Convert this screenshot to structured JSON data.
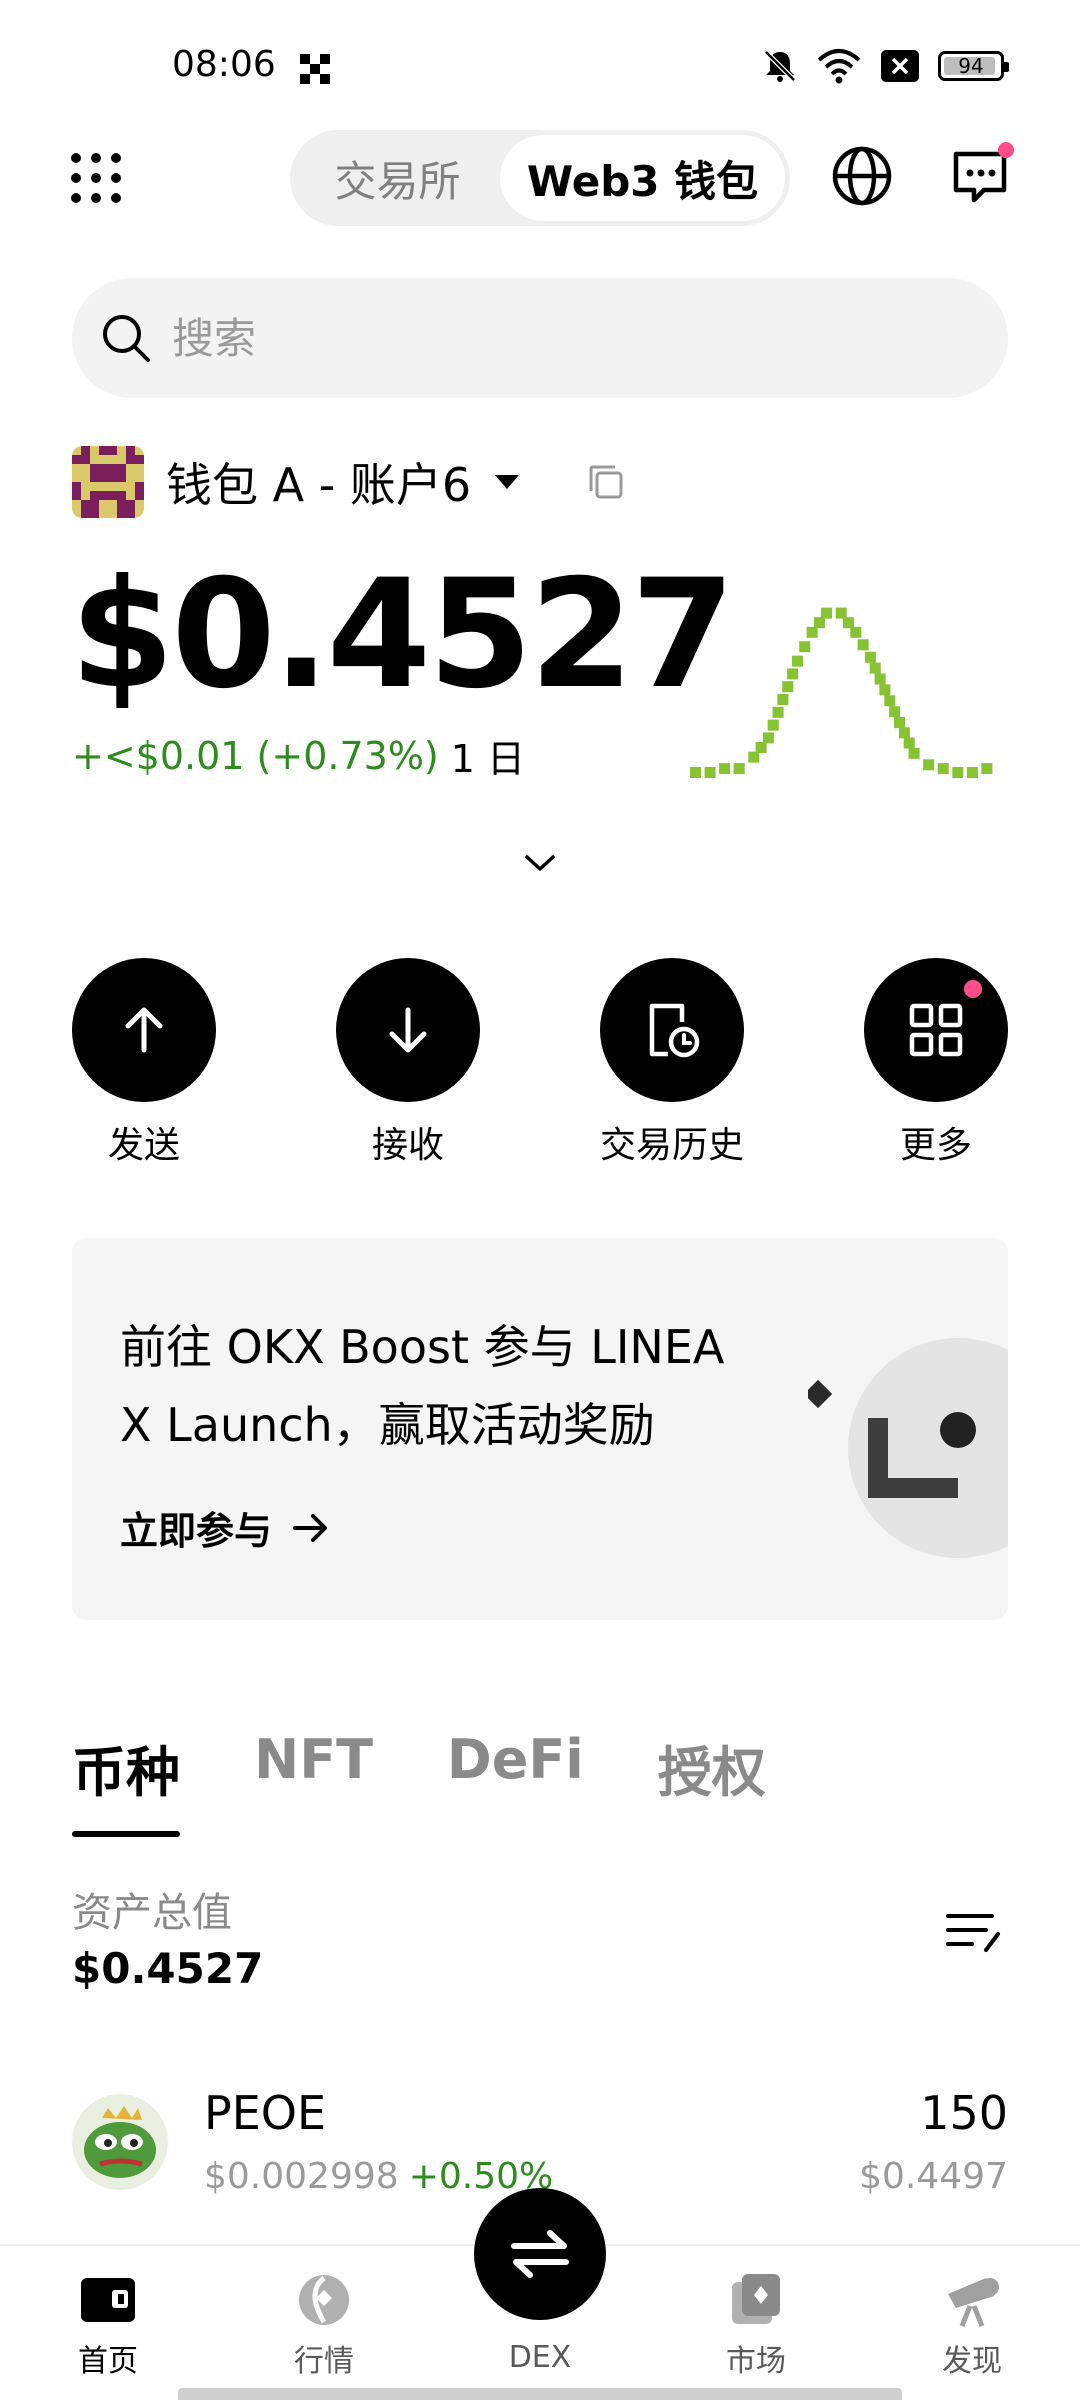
{
  "status_bar": {
    "time": "08:06",
    "battery": "94",
    "battery_level_pct": 94
  },
  "header": {
    "tab_exchange": "交易所",
    "tab_wallet": "Web3 钱包"
  },
  "search": {
    "placeholder": "搜索"
  },
  "account": {
    "name": "钱包 A - 账户6"
  },
  "balance": {
    "value": "$0.4527",
    "change": "+<$0.01 (+0.73%)",
    "period": "1 日"
  },
  "sparkline": {
    "color": "#86c232",
    "values": [
      0.12,
      0.12,
      0.14,
      0.14,
      0.2,
      0.3,
      0.5,
      0.7,
      0.85,
      0.95,
      0.95,
      0.85,
      0.72,
      0.55,
      0.38,
      0.22,
      0.16,
      0.14,
      0.12,
      0.12,
      0.14,
      0.16
    ]
  },
  "actions": [
    {
      "label": "发送",
      "icon": "arrow-up-icon"
    },
    {
      "label": "接收",
      "icon": "arrow-down-icon"
    },
    {
      "label": "交易历史",
      "icon": "history-icon"
    },
    {
      "label": "更多",
      "icon": "grid-more-icon"
    }
  ],
  "banner": {
    "text": "前往 OKX Boost 参与 LINEA X Launch，赢取活动奖励",
    "cta": "立即参与"
  },
  "tabs": [
    "币种",
    "NFT",
    "DeFi",
    "授权"
  ],
  "assets": {
    "total_label": "资产总值",
    "total_value": "$0.4527"
  },
  "tokens": [
    {
      "name": "PEOE",
      "price": "$0.002998",
      "change": "+0.50%",
      "amount": "150",
      "value": "$0.4497"
    }
  ],
  "bottom_nav": {
    "home": "首页",
    "market": "行情",
    "dex": "DEX",
    "marketplace": "市场",
    "discover": "发现"
  },
  "colors": {
    "accent_green": "#2e8b1e",
    "badge_pink": "#ff4d8c"
  }
}
